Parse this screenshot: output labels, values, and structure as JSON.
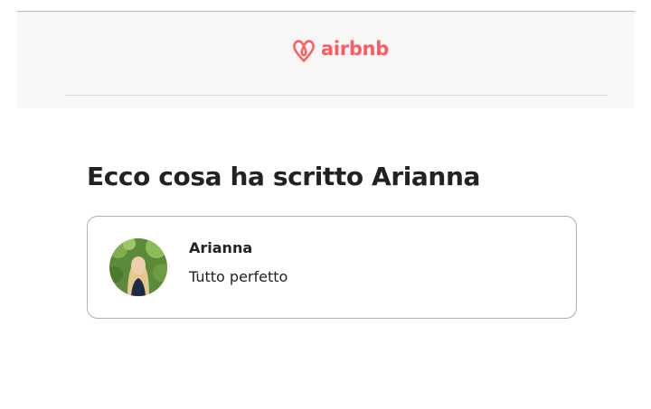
{
  "header": {
    "logo_text": "airbnb",
    "logo_icon": "airbnb-belo-icon",
    "brand_color": "#ff5a5f"
  },
  "main": {
    "heading": "Ecco cosa ha scritto Arianna"
  },
  "review": {
    "reviewer_name": "Arianna",
    "text": "Tutto perfetto",
    "avatar": "reviewer-avatar-photo"
  }
}
